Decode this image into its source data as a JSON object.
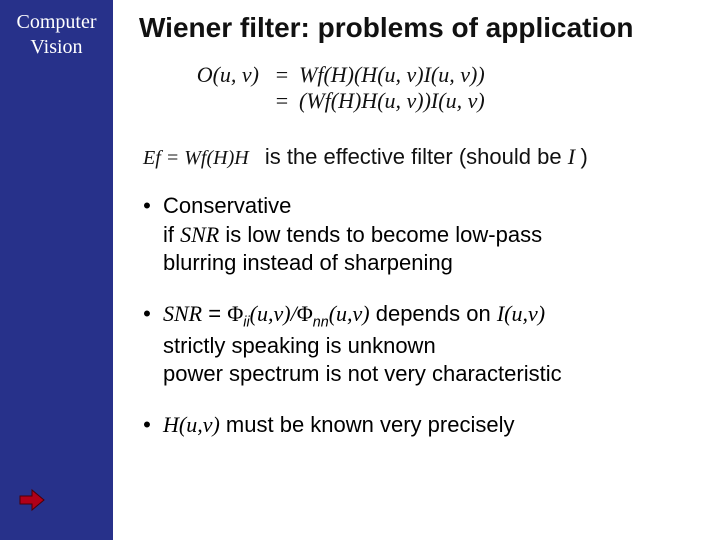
{
  "sidebar": {
    "title_line1": "Computer",
    "title_line2": "Vision",
    "arrow_icon": "arrow-right-icon"
  },
  "title": "Wiener filter: problems of application",
  "equations": {
    "row1": {
      "lhs": "O(u, v)",
      "sign": "=",
      "rhs": "Wf(H)(H(u, v)I(u, v))"
    },
    "row2": {
      "lhs": "",
      "sign": "=",
      "rhs": "(Wf(H)H(u, v))I(u, v)"
    }
  },
  "effective": {
    "lhs": "Ef = Wf(H)H",
    "text_before": " is the effective filter (should be ",
    "symbol": "I ",
    "text_after": ")"
  },
  "bullets": {
    "b1": {
      "dot": "•",
      "head": "Conservative",
      "line2_pre": "if ",
      "line2_snr": "SNR",
      "line2_post": " is low tends to become low-pass",
      "line3": "blurring instead of sharpening"
    },
    "b2": {
      "dot": "•",
      "snr": "SNR",
      "eq": " = ",
      "phi1": "Φ",
      "sub1": "ii",
      "args": "(u,v)/",
      "phi2": "Φ",
      "sub2": "nn",
      "args2": "(u,v)",
      "depends": "  depends on ",
      "iuv": "I(u,v)",
      "line2": "strictly speaking is unknown",
      "line3": "power spectrum is not very characteristic"
    },
    "b3": {
      "dot": "•",
      "huv": "H(u,v)",
      "text": "  must be known very precisely"
    }
  }
}
